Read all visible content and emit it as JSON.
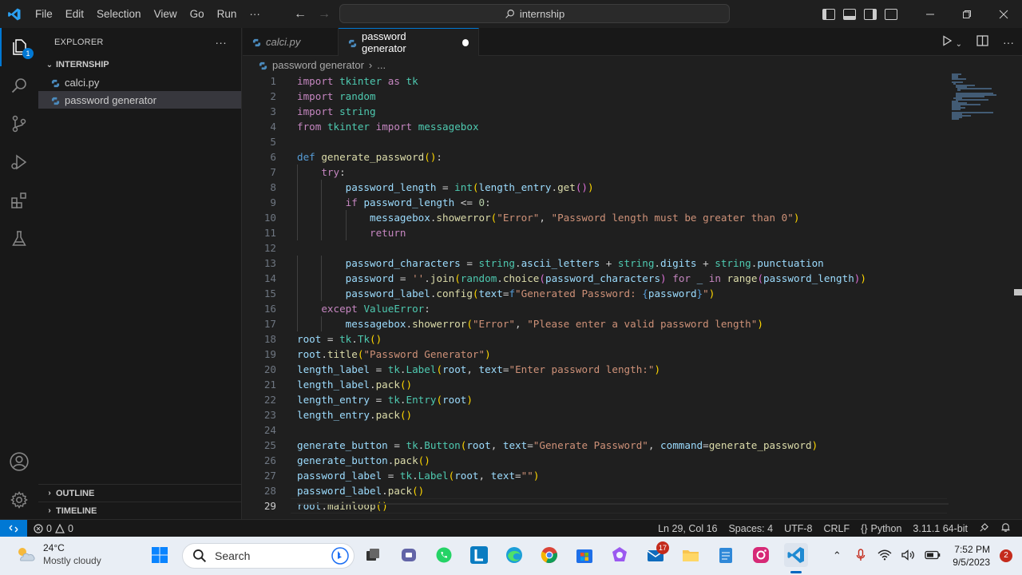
{
  "titlebar": {
    "menu": [
      "File",
      "Edit",
      "Selection",
      "View",
      "Go",
      "Run",
      "···"
    ],
    "search_text": "internship"
  },
  "activity": {
    "explorer_badge": "1"
  },
  "sidebar": {
    "title": "EXPLORER",
    "more": "···",
    "folder": "INTERNSHIP",
    "files": [
      "calci.py",
      "password generator"
    ],
    "sections": [
      "OUTLINE",
      "TIMELINE"
    ]
  },
  "tabs": [
    {
      "label": "calci.py",
      "italic": true
    },
    {
      "label": "password generator",
      "modified": true
    }
  ],
  "breadcrumb": {
    "file": "password generator",
    "more": "..."
  },
  "editor": {
    "current_line": 29,
    "line_numbers": [
      "1",
      "2",
      "3",
      "4",
      "5",
      "6",
      "7",
      "8",
      "9",
      "10",
      "11",
      "12",
      "13",
      "14",
      "15",
      "16",
      "17",
      "18",
      "19",
      "20",
      "21",
      "22",
      "23",
      "24",
      "25",
      "26",
      "27",
      "28",
      "29"
    ],
    "lines": [
      [
        [
          "k",
          "import"
        ],
        [
          "t",
          " "
        ],
        [
          "m",
          "tkinter"
        ],
        [
          "t",
          " "
        ],
        [
          "k",
          "as"
        ],
        [
          "t",
          " "
        ],
        [
          "m",
          "tk"
        ]
      ],
      [
        [
          "k",
          "import"
        ],
        [
          "t",
          " "
        ],
        [
          "m",
          "random"
        ]
      ],
      [
        [
          "k",
          "import"
        ],
        [
          "t",
          " "
        ],
        [
          "m",
          "string"
        ]
      ],
      [
        [
          "k",
          "from"
        ],
        [
          "t",
          " "
        ],
        [
          "m",
          "tkinter"
        ],
        [
          "t",
          " "
        ],
        [
          "k",
          "import"
        ],
        [
          "t",
          " "
        ],
        [
          "m",
          "messagebox"
        ]
      ],
      [],
      [
        [
          "d",
          "def"
        ],
        [
          "t",
          " "
        ],
        [
          "f",
          "generate_password"
        ],
        [
          "bk",
          "()"
        ],
        [
          "t",
          ":"
        ]
      ],
      [
        [
          "t",
          "    "
        ],
        [
          "k",
          "try"
        ],
        [
          "t",
          ":"
        ]
      ],
      [
        [
          "t",
          "        "
        ],
        [
          "v",
          "password_length"
        ],
        [
          "t",
          " = "
        ],
        [
          "m",
          "int"
        ],
        [
          "bk",
          "("
        ],
        [
          "v",
          "length_entry"
        ],
        [
          "t",
          "."
        ],
        [
          "f",
          "get"
        ],
        [
          "bp",
          "()"
        ],
        [
          "bk",
          ")"
        ]
      ],
      [
        [
          "t",
          "        "
        ],
        [
          "k",
          "if"
        ],
        [
          "t",
          " "
        ],
        [
          "v",
          "password_length"
        ],
        [
          "t",
          " <= "
        ],
        [
          "n",
          "0"
        ],
        [
          "t",
          ":"
        ]
      ],
      [
        [
          "t",
          "            "
        ],
        [
          "v",
          "messagebox"
        ],
        [
          "t",
          "."
        ],
        [
          "f",
          "showerror"
        ],
        [
          "bk",
          "("
        ],
        [
          "s",
          "\"Error\""
        ],
        [
          "t",
          ", "
        ],
        [
          "s",
          "\"Password length must be greater than 0\""
        ],
        [
          "bk",
          ")"
        ]
      ],
      [
        [
          "t",
          "            "
        ],
        [
          "k",
          "return"
        ]
      ],
      [],
      [
        [
          "t",
          "        "
        ],
        [
          "v",
          "password_characters"
        ],
        [
          "t",
          " = "
        ],
        [
          "m",
          "string"
        ],
        [
          "t",
          "."
        ],
        [
          "v",
          "ascii_letters"
        ],
        [
          "t",
          " + "
        ],
        [
          "m",
          "string"
        ],
        [
          "t",
          "."
        ],
        [
          "v",
          "digits"
        ],
        [
          "t",
          " + "
        ],
        [
          "m",
          "string"
        ],
        [
          "t",
          "."
        ],
        [
          "v",
          "punctuation"
        ]
      ],
      [
        [
          "t",
          "        "
        ],
        [
          "v",
          "password"
        ],
        [
          "t",
          " = "
        ],
        [
          "s",
          "''"
        ],
        [
          "t",
          "."
        ],
        [
          "f",
          "join"
        ],
        [
          "bk",
          "("
        ],
        [
          "m",
          "random"
        ],
        [
          "t",
          "."
        ],
        [
          "f",
          "choice"
        ],
        [
          "bp",
          "("
        ],
        [
          "v",
          "password_characters"
        ],
        [
          "bp",
          ")"
        ],
        [
          "t",
          " "
        ],
        [
          "k",
          "for"
        ],
        [
          "t",
          " "
        ],
        [
          "v",
          "_"
        ],
        [
          "t",
          " "
        ],
        [
          "k",
          "in"
        ],
        [
          "t",
          " "
        ],
        [
          "f",
          "range"
        ],
        [
          "bp",
          "("
        ],
        [
          "v",
          "password_length"
        ],
        [
          "bp",
          ")"
        ],
        [
          "bk",
          ")"
        ]
      ],
      [
        [
          "t",
          "        "
        ],
        [
          "v",
          "password_label"
        ],
        [
          "t",
          "."
        ],
        [
          "f",
          "config"
        ],
        [
          "bk",
          "("
        ],
        [
          "v",
          "text"
        ],
        [
          "t",
          "="
        ],
        [
          "d",
          "f"
        ],
        [
          "s",
          "\"Generated Password: "
        ],
        [
          "d",
          "{"
        ],
        [
          "v",
          "password"
        ],
        [
          "d",
          "}"
        ],
        [
          "s",
          "\""
        ],
        [
          "bk",
          ")"
        ]
      ],
      [
        [
          "t",
          "    "
        ],
        [
          "k",
          "except"
        ],
        [
          "t",
          " "
        ],
        [
          "m",
          "ValueError"
        ],
        [
          "t",
          ":"
        ]
      ],
      [
        [
          "t",
          "        "
        ],
        [
          "v",
          "messagebox"
        ],
        [
          "t",
          "."
        ],
        [
          "f",
          "showerror"
        ],
        [
          "bk",
          "("
        ],
        [
          "s",
          "\"Error\""
        ],
        [
          "t",
          ", "
        ],
        [
          "s",
          "\"Please enter a valid password length\""
        ],
        [
          "bk",
          ")"
        ]
      ],
      [
        [
          "v",
          "root"
        ],
        [
          "t",
          " = "
        ],
        [
          "m",
          "tk"
        ],
        [
          "t",
          "."
        ],
        [
          "m",
          "Tk"
        ],
        [
          "bk",
          "()"
        ]
      ],
      [
        [
          "v",
          "root"
        ],
        [
          "t",
          "."
        ],
        [
          "f",
          "title"
        ],
        [
          "bk",
          "("
        ],
        [
          "s",
          "\"Password Generator\""
        ],
        [
          "bk",
          ")"
        ]
      ],
      [
        [
          "v",
          "length_label"
        ],
        [
          "t",
          " = "
        ],
        [
          "m",
          "tk"
        ],
        [
          "t",
          "."
        ],
        [
          "m",
          "Label"
        ],
        [
          "bk",
          "("
        ],
        [
          "v",
          "root"
        ],
        [
          "t",
          ", "
        ],
        [
          "v",
          "text"
        ],
        [
          "t",
          "="
        ],
        [
          "s",
          "\"Enter password length:\""
        ],
        [
          "bk",
          ")"
        ]
      ],
      [
        [
          "v",
          "length_label"
        ],
        [
          "t",
          "."
        ],
        [
          "f",
          "pack"
        ],
        [
          "bk",
          "()"
        ]
      ],
      [
        [
          "v",
          "length_entry"
        ],
        [
          "t",
          " = "
        ],
        [
          "m",
          "tk"
        ],
        [
          "t",
          "."
        ],
        [
          "m",
          "Entry"
        ],
        [
          "bk",
          "("
        ],
        [
          "v",
          "root"
        ],
        [
          "bk",
          ")"
        ]
      ],
      [
        [
          "v",
          "length_entry"
        ],
        [
          "t",
          "."
        ],
        [
          "f",
          "pack"
        ],
        [
          "bk",
          "()"
        ]
      ],
      [],
      [
        [
          "v",
          "generate_button"
        ],
        [
          "t",
          " = "
        ],
        [
          "m",
          "tk"
        ],
        [
          "t",
          "."
        ],
        [
          "m",
          "Button"
        ],
        [
          "bk",
          "("
        ],
        [
          "v",
          "root"
        ],
        [
          "t",
          ", "
        ],
        [
          "v",
          "text"
        ],
        [
          "t",
          "="
        ],
        [
          "s",
          "\"Generate Password\""
        ],
        [
          "t",
          ", "
        ],
        [
          "v",
          "command"
        ],
        [
          "t",
          "="
        ],
        [
          "f",
          "generate_password"
        ],
        [
          "bk",
          ")"
        ]
      ],
      [
        [
          "v",
          "generate_button"
        ],
        [
          "t",
          "."
        ],
        [
          "f",
          "pack"
        ],
        [
          "bk",
          "()"
        ]
      ],
      [
        [
          "v",
          "password_label"
        ],
        [
          "t",
          " = "
        ],
        [
          "m",
          "tk"
        ],
        [
          "t",
          "."
        ],
        [
          "m",
          "Label"
        ],
        [
          "bk",
          "("
        ],
        [
          "v",
          "root"
        ],
        [
          "t",
          ", "
        ],
        [
          "v",
          "text"
        ],
        [
          "t",
          "="
        ],
        [
          "s",
          "\"\""
        ],
        [
          "bk",
          ")"
        ]
      ],
      [
        [
          "v",
          "password_label"
        ],
        [
          "t",
          "."
        ],
        [
          "f",
          "pack"
        ],
        [
          "bk",
          "()"
        ]
      ],
      [
        [
          "v",
          "root"
        ],
        [
          "t",
          "."
        ],
        [
          "f",
          "mainloop"
        ],
        [
          "bk",
          "()"
        ]
      ]
    ]
  },
  "status": {
    "errors": "0",
    "warnings": "0",
    "position": "Ln 29, Col 16",
    "spaces": "Spaces: 4",
    "encoding": "UTF-8",
    "eol": "CRLF",
    "language": "Python",
    "interpreter": "3.11.1 64-bit"
  },
  "taskbar": {
    "temperature": "24°C",
    "weather": "Mostly cloudy",
    "search_label": "Search",
    "mail_badge": "17",
    "time": "7:52 PM",
    "date": "9/5/2023",
    "notifications": "2"
  },
  "colors": {
    "accent": "#0078d4",
    "editor_bg": "#1f1f1f",
    "sidebar_bg": "#181818"
  }
}
